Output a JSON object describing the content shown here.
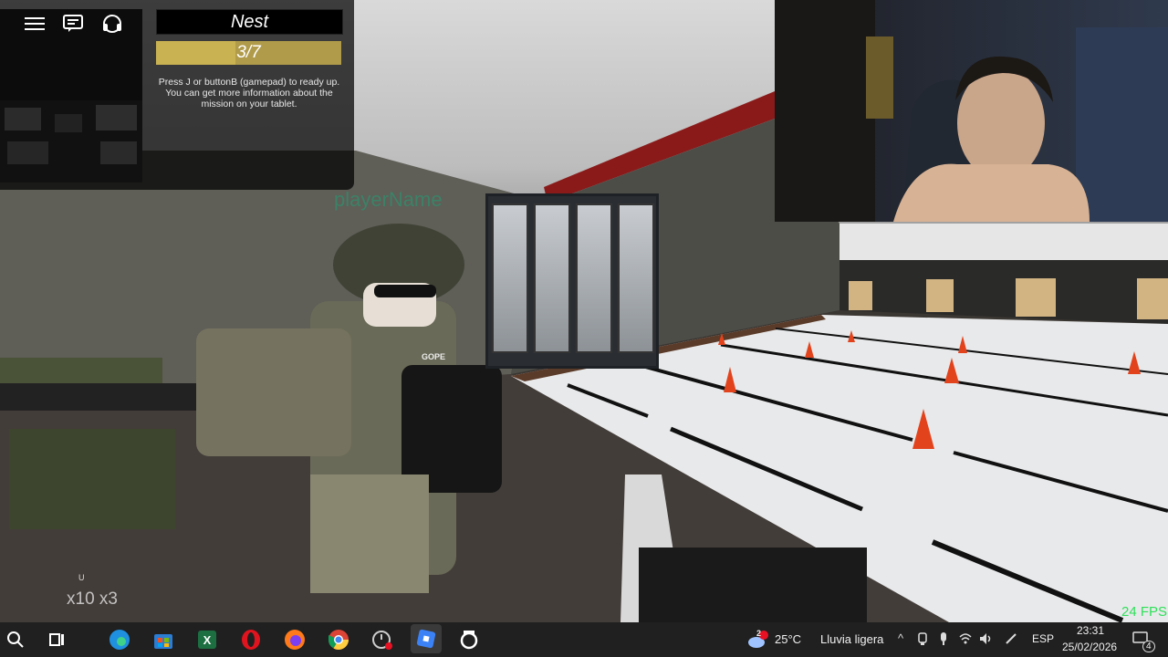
{
  "hud": {
    "mission_title": "Nest",
    "progress_text": "3/7",
    "progress_value": 0.4286,
    "ready_text": "Press J or buttonB (gamepad)  to ready up. You can get more information about the mission on your tablet.",
    "icons": [
      "menu-icon",
      "chat-icon",
      "headset-icon"
    ]
  },
  "world": {
    "player_name": "playerName",
    "vest_label": "GOPE"
  },
  "weapon": {
    "slot_label": "U",
    "ammo_text": "x10 x3"
  },
  "fps_text": "24 FPS",
  "taskbar": {
    "apps": [
      "search-icon",
      "task-view-icon",
      "edge-icon",
      "store-icon",
      "excel-icon",
      "opera-icon",
      "firefox-icon",
      "chrome-icon",
      "clock-app-icon",
      "roblox-icon",
      "roblox-player-icon"
    ],
    "weather": {
      "temp": "25°C",
      "desc": "Lluvia ligera",
      "badge": "2"
    },
    "language": "ESP",
    "time": "23:31",
    "date": "25/02/2026",
    "notif_count": "4"
  },
  "colors": {
    "fps_green": "#2fe05a",
    "progress_gold": "#c9b252",
    "player_name_green": "#2f8f6d",
    "taskbar_bg": "#202020"
  }
}
